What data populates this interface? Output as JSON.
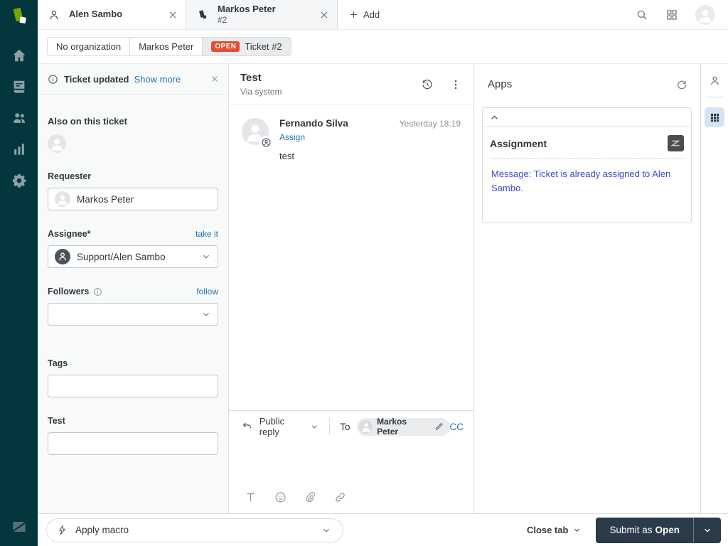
{
  "topbar": {
    "tabs": [
      {
        "title": "Alen Sambo",
        "subtitle": ""
      },
      {
        "title": "Markos Peter",
        "subtitle": "#2"
      }
    ],
    "add_label": "Add"
  },
  "breadcrumb": {
    "org": "No organization",
    "person": "Markos Peter",
    "status": "OPEN",
    "ticket": "Ticket #2"
  },
  "ticket_panel": {
    "toast_title": "Ticket updated",
    "toast_link": "Show more",
    "also_on": "Also on this ticket",
    "requester_label": "Requester",
    "requester_value": "Markos Peter",
    "assignee_label": "Assignee*",
    "assignee_action": "take it",
    "assignee_value": "Support/Alen Sambo",
    "followers_label": "Followers",
    "followers_action": "follow",
    "tags_label": "Tags",
    "custom_field_label": "Test"
  },
  "conversation": {
    "title": "Test",
    "via": "Via system",
    "message": {
      "author": "Fernando Silva",
      "timestamp": "Yesterday 18:19",
      "action": "Assign",
      "body": "test"
    }
  },
  "apps_panel": {
    "title": "Apps",
    "app_title": "Assignment",
    "app_message": "Message: Ticket is already assigned to Alen Sambo."
  },
  "composer": {
    "reply_type": "Public reply",
    "to_label": "To",
    "recipient": "Markos Peter",
    "cc_label": "CC"
  },
  "footer": {
    "apply_macro": "Apply macro",
    "close_tab": "Close tab",
    "submit_prefix": "Submit as",
    "submit_status": "Open"
  },
  "colors": {
    "sidebar_bg": "#03363d",
    "link": "#1f73b7",
    "open_badge": "#e34f32",
    "app_message": "#3b4bc8",
    "submit_bg": "#2c3b49",
    "logo_green": "#78a300"
  }
}
